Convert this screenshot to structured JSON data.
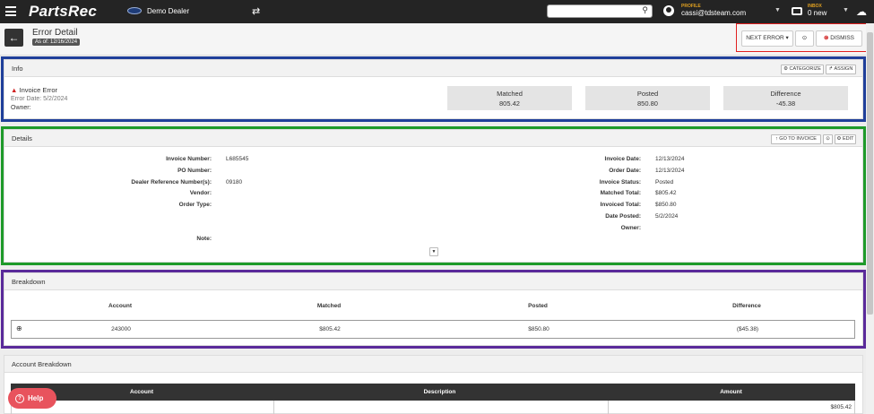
{
  "app": {
    "name": "PartsRec",
    "dealer": "Demo Dealer"
  },
  "search": {
    "placeholder": ""
  },
  "profile": {
    "label": "PROFILE",
    "email": "cassi@tdsteam.com"
  },
  "inbox": {
    "label": "INBOX",
    "count_text": "0 new"
  },
  "page": {
    "title": "Error Detail",
    "as_of": "As of: 12/16/2024"
  },
  "actions": {
    "next_error": "NEXT ERROR",
    "dismiss": "DISMISS"
  },
  "info": {
    "header": "Info",
    "categorize": "CATEGORIZE",
    "assign": "ASSIGN",
    "error_type": "Invoice Error",
    "error_date": "Error Date: 5/2/2024",
    "owner": "Owner:",
    "stats": [
      {
        "label": "Matched",
        "value": "805.42"
      },
      {
        "label": "Posted",
        "value": "850.80"
      },
      {
        "label": "Difference",
        "value": "-45.38"
      }
    ]
  },
  "details": {
    "header": "Details",
    "goto_invoice": "GO TO INVOICE",
    "edit": "EDIT",
    "left": [
      {
        "label": "Invoice Number:",
        "value": "L685545"
      },
      {
        "label": "PO Number:",
        "value": ""
      },
      {
        "label": "Dealer Reference Number(s):",
        "value": "09180"
      },
      {
        "label": "Vendor:",
        "value": ""
      },
      {
        "label": "Order Type:",
        "value": ""
      }
    ],
    "note_label": "Note:",
    "right": [
      {
        "label": "Invoice Date:",
        "value": "12/13/2024"
      },
      {
        "label": "Order Date:",
        "value": "12/13/2024"
      },
      {
        "label": "Invoice Status:",
        "value": "Posted"
      },
      {
        "label": "Matched Total:",
        "value": "$805.42"
      },
      {
        "label": "Invoiced Total:",
        "value": "$850.80"
      },
      {
        "label": "Date Posted:",
        "value": "5/2/2024"
      },
      {
        "label": "Owner:",
        "value": ""
      }
    ]
  },
  "breakdown": {
    "header": "Breakdown",
    "columns": [
      "Account",
      "Matched",
      "Posted",
      "Difference"
    ],
    "rows": [
      {
        "account": "243000",
        "matched": "$805.42",
        "posted": "$850.80",
        "difference": "($45.38)"
      }
    ]
  },
  "account_breakdown": {
    "header": "Account Breakdown",
    "columns": [
      "Account",
      "Description",
      "Amount"
    ],
    "first_amount": "$805.42"
  },
  "help": {
    "label": "Help"
  },
  "colors": {
    "info_outline": "#1f3f9a",
    "details_outline": "#1e9a2a",
    "breakdown_outline": "#5a2a9a",
    "actions_outline": "#e02020",
    "help": "#e8535d",
    "topbar": "#242424"
  }
}
